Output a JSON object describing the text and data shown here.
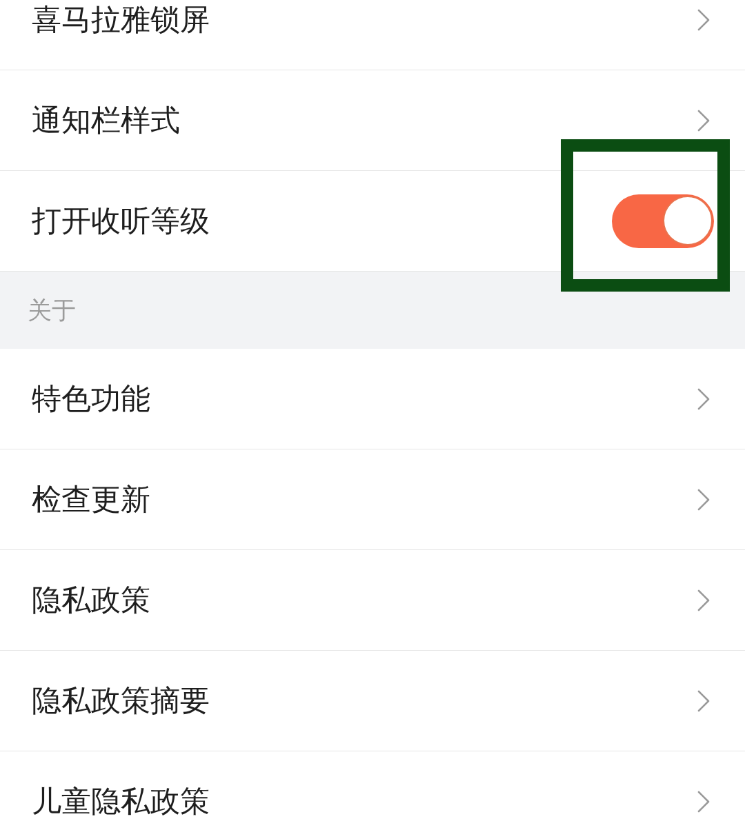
{
  "sections": [
    {
      "rows": [
        {
          "label": "喜马拉雅锁屏",
          "kind": "link"
        },
        {
          "label": "通知栏样式",
          "kind": "link"
        },
        {
          "label": "打开收听等级",
          "kind": "switch",
          "on": true
        }
      ]
    },
    {
      "header": "关于",
      "rows": [
        {
          "label": "特色功能",
          "kind": "link"
        },
        {
          "label": "检查更新",
          "kind": "link"
        },
        {
          "label": "隐私政策",
          "kind": "link"
        },
        {
          "label": "隐私政策摘要",
          "kind": "link"
        },
        {
          "label": "儿童隐私政策",
          "kind": "link"
        }
      ]
    }
  ]
}
